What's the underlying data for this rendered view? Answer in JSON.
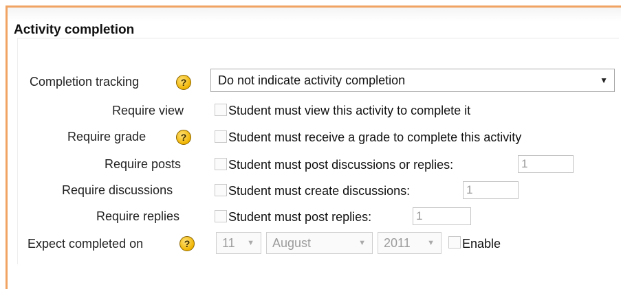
{
  "section": {
    "title": "Activity completion"
  },
  "completion_tracking": {
    "label": "Completion tracking",
    "help_icon": "question-icon",
    "selected": "Do not indicate activity completion"
  },
  "require_view": {
    "label": "Require view",
    "checkbox_label": "Student must view this activity to complete it",
    "checked": false
  },
  "require_grade": {
    "label": "Require grade",
    "help_icon": "question-icon",
    "checkbox_label": "Student must receive a grade to complete this activity",
    "checked": false
  },
  "require_posts": {
    "label": "Require posts",
    "checkbox_label": "Student must post discussions or replies:",
    "value": "1",
    "checked": false
  },
  "require_discussions": {
    "label": "Require discussions",
    "checkbox_label": "Student must create discussions:",
    "value": "1",
    "checked": false
  },
  "require_replies": {
    "label": "Require replies",
    "checkbox_label": "Student must post replies:",
    "value": "1",
    "checked": false
  },
  "expect_completed": {
    "label": "Expect completed on",
    "help_icon": "question-icon",
    "day": "11",
    "month": "August",
    "year": "2011",
    "enable_label": "Enable",
    "enabled": false
  },
  "colors": {
    "frame_accent": "#f0a363",
    "help_icon": "#f0b400"
  }
}
